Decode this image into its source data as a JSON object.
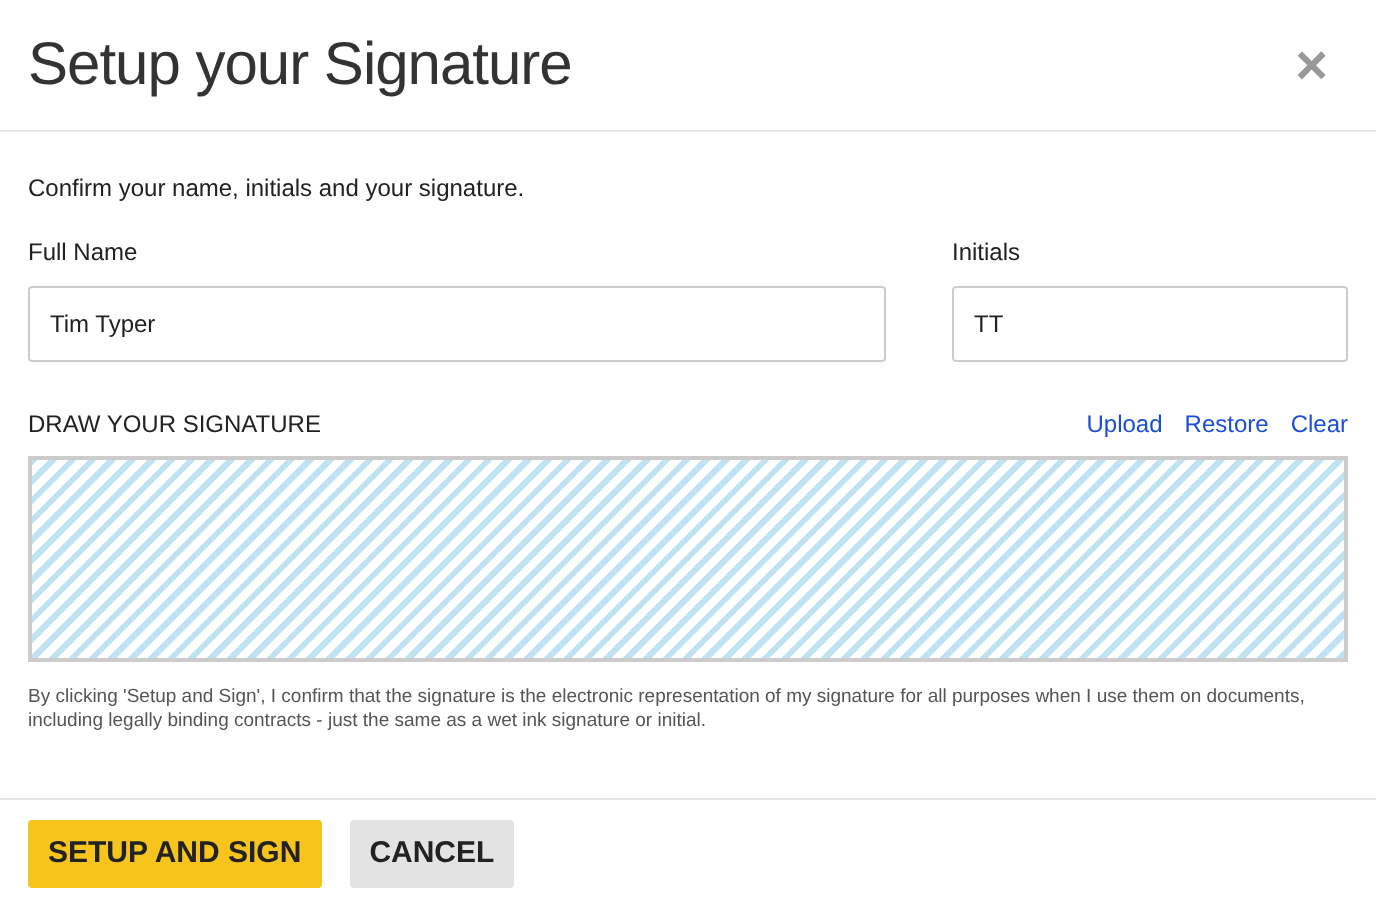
{
  "dialog": {
    "title": "Setup your Signature",
    "close": "×"
  },
  "intro": "Confirm your name, initials and your signature.",
  "fields": [
    {
      "label": "Full Name",
      "value": "Tim Typer"
    },
    {
      "label": "Initials",
      "value": "TT"
    }
  ],
  "signature": {
    "label": "DRAW YOUR SIGNATURE",
    "links": [
      "Upload",
      "Restore",
      "Clear"
    ]
  },
  "disclaimer": "By clicking 'Setup and Sign', I confirm that the signature is the electronic representation of my signature for all purposes when I use them on documents, including legally binding contracts - just the same as a wet ink signature or initial.",
  "buttons": [
    {
      "label": "SETUP AND SIGN",
      "kind": "primary"
    },
    {
      "label": "CANCEL",
      "kind": "secondary"
    }
  ]
}
